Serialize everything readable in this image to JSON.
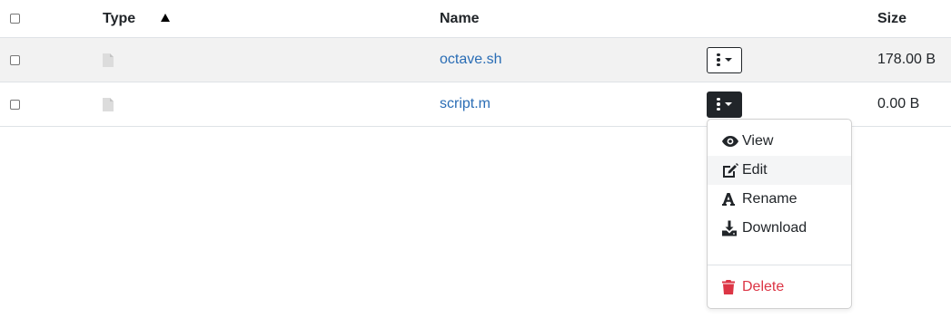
{
  "table": {
    "headers": {
      "type": "Type",
      "name": "Name",
      "size": "Size"
    },
    "sort": {
      "column": "Type",
      "direction": "ascending"
    },
    "rows": [
      {
        "name": "octave.sh",
        "size": "178.00 B",
        "icon": "file-icon"
      },
      {
        "name": "script.m",
        "size": "0.00 B",
        "icon": "file-icon"
      }
    ]
  },
  "dropdown": {
    "open_for_row": "script.m",
    "items": [
      {
        "label": "View",
        "icon": "eye-icon"
      },
      {
        "label": "Edit",
        "icon": "edit-icon"
      },
      {
        "label": "Rename",
        "icon": "rename-icon"
      },
      {
        "label": "Download",
        "icon": "download-icon"
      }
    ],
    "delete": {
      "label": "Delete",
      "icon": "trash-icon"
    }
  },
  "colors": {
    "link": "#2a6db5",
    "danger": "#dc3545",
    "dark": "#212529",
    "stripe": "#f2f2f2"
  }
}
